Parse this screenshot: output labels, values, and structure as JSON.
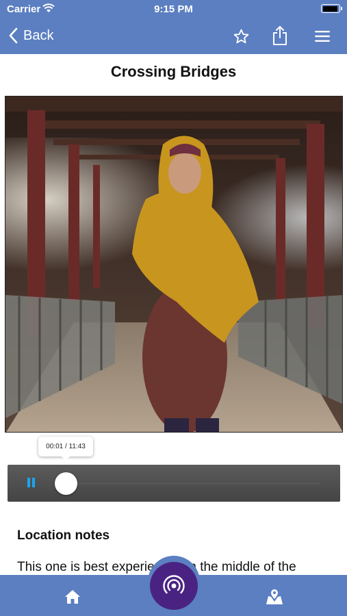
{
  "status_bar": {
    "carrier": "Carrier",
    "time": "9:15 PM"
  },
  "nav": {
    "back_label": "Back",
    "icons": [
      "star-icon",
      "share-icon",
      "menu-icon"
    ]
  },
  "page": {
    "title": "Crossing Bridges"
  },
  "hero_image": {
    "description_icon": "photo"
  },
  "player": {
    "time_display": "00:01 / 11:43",
    "progress_fraction": 0.0014,
    "state": "playing"
  },
  "location_notes": {
    "heading": "Location notes",
    "text": "This one is best experienced in the middle of the"
  },
  "tab_bar": {
    "icons": [
      "home-icon",
      "listen-icon",
      "map-icon"
    ]
  },
  "colors": {
    "bar": "#5b7fc1",
    "fab": "#4a2382",
    "accent": "#19a5ee"
  }
}
